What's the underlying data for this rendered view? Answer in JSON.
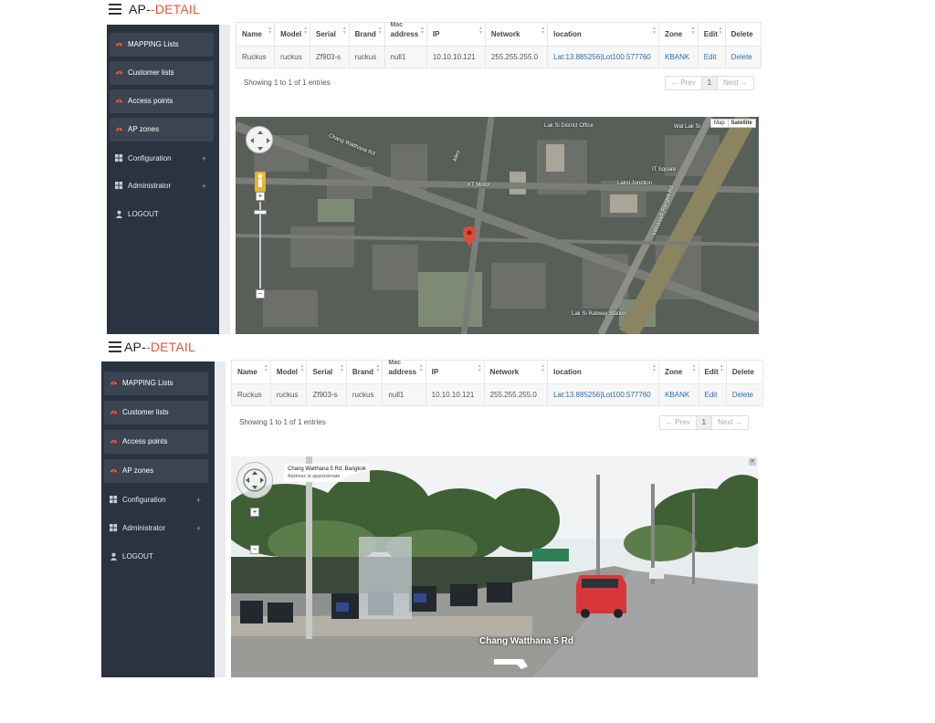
{
  "app": {
    "brand_part1": "AP-",
    "brand_part2": "-DETAIL"
  },
  "sidebar": {
    "items": [
      {
        "label": "MAPPING Lists",
        "icon": "gauge-icon"
      },
      {
        "label": "Customer lists",
        "icon": "gauge-icon"
      },
      {
        "label": "Access points",
        "icon": "gauge-icon"
      },
      {
        "label": "AP zones",
        "icon": "gauge-icon"
      },
      {
        "label": "Configuration",
        "icon": "grid-icon",
        "expand": "+"
      },
      {
        "label": "Administrator",
        "icon": "grid-icon",
        "expand": "+"
      },
      {
        "label": "LOGOUT",
        "icon": "user-icon"
      }
    ]
  },
  "table": {
    "columns": [
      "Name",
      "Model",
      "Serial",
      "Brand",
      "address",
      "IP",
      "Network",
      "location",
      "Zone",
      "Edit",
      "Delete"
    ],
    "col_stub": "Mac",
    "rows": [
      {
        "name": "Ruckus",
        "model": "ruckus",
        "serial": "Zf903-s",
        "brand": "ruckus",
        "mac": "null1",
        "ip": "10.10.10.121",
        "network": "255.255.255.0",
        "location": "Lat:13.885256|Lot100.577760",
        "zone": "KBANK",
        "edit": "Edit",
        "delete": "Delete"
      }
    ],
    "info": "Showing 1 to 1 of 1 entries"
  },
  "pager": {
    "prev": "← Prev",
    "page": "1",
    "next": "Next →"
  },
  "map": {
    "type_map": "Map",
    "type_satellite": "Satellite",
    "labels": [
      "Chang Watthana Rd",
      "Lak Si District Office",
      "Wat Lak Si",
      "KT Motor",
      "Laksi Junction",
      "IT Square",
      "Lak Si Railway Station",
      "Vibhavadi Rangsit Rd",
      "Alley"
    ]
  },
  "streetview": {
    "card_title": "Chang Watthana 5 Rd, Bangkok",
    "card_sub": "Address is approximate",
    "road_label": "Chang Watthana 5 Rd",
    "close": "×"
  },
  "colors": {
    "accent": "#e8553a",
    "sidebar": "#2a3340",
    "link": "#2a6db3"
  }
}
